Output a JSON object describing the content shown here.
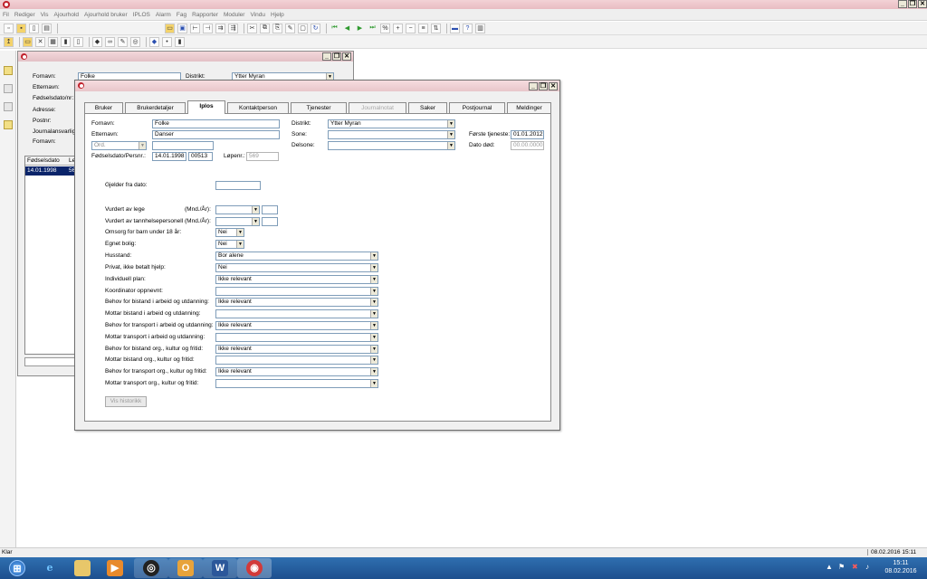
{
  "app": {
    "titlebar_buttons": {
      "minimize": "_",
      "restore": "❐",
      "close": "✕"
    }
  },
  "menu": [
    "Fil",
    "Rediger",
    "Vis",
    "Ajourhold",
    "Ajourhold bruker",
    "IPLOS",
    "Alarm",
    "Fag",
    "Rapporter",
    "Moduler",
    "Vindu",
    "Hjelp"
  ],
  "background_window": {
    "labels": {
      "fornavn": "Fornavn:",
      "etternavn": "Etternavn:",
      "fodselsdato": "Fødselsdato/nr:",
      "adresse": "Adresse:",
      "postnr": "Postnr:",
      "journalansvarlig": "Journalansvarlig",
      "fornavn2": "Fornavn:",
      "distrikt": "Distrikt:"
    },
    "fornavn_value": "Folke",
    "distrikt_value": "Ytter Myran",
    "grid_headers": [
      "Fødselsdato",
      "Le"
    ],
    "grid_rows": [
      [
        "14.01.1998",
        "56"
      ]
    ]
  },
  "dialog": {
    "tabs": [
      {
        "label": "Bruker",
        "state": "normal"
      },
      {
        "label": "Brukerdetaljer",
        "state": "normal"
      },
      {
        "label": "Iplos",
        "state": "active"
      },
      {
        "label": "Kontaktperson",
        "state": "normal"
      },
      {
        "label": "Tjenester",
        "state": "normal"
      },
      {
        "label": "Journalnotat",
        "state": "disabled"
      },
      {
        "label": "Saker",
        "state": "normal"
      },
      {
        "label": "Postjournal",
        "state": "normal"
      },
      {
        "label": "Meldinger",
        "state": "normal"
      }
    ],
    "header": {
      "fornavn_label": "Fornavn:",
      "fornavn_value": "Folke",
      "etternavn_label": "Etternavn:",
      "etternavn_value": "Danser",
      "ord_value": "Ord.",
      "fodselsdato_label": "Fødselsdato/Persnr.:",
      "fodselsdato_value": "14.01.1998",
      "persnr_value": "00513",
      "lopenr_label": "Løpenr.:",
      "lopenr_value": "569",
      "distrikt_label": "Distrikt:",
      "distrikt_value": "Ytter Myran",
      "sone_label": "Sone:",
      "delsone_label": "Delsone:",
      "forste_tjeneste_label": "Første tjeneste:",
      "forste_tjeneste_value": "01.01.2012",
      "dato_dod_label": "Dato død:",
      "dato_dod_value": "00.00.0000"
    },
    "gjelder_fra_dato_label": "Gjelder fra dato:",
    "vurdert_lege_label": "Vurdert av lege",
    "vurdert_lege_unit": "(Mnd./År):",
    "vurdert_tann_label": "Vurdert av tannhelsepersonell",
    "vurdert_tann_unit": "(Mnd./År):",
    "omsorg_label": "Omsorg for barn under 18 år:",
    "omsorg_value": "Nei",
    "egnet_bolig_label": "Egnet bolig:",
    "egnet_bolig_value": "Nei",
    "rows": [
      {
        "label": "Husstand:",
        "value": "Bor alene"
      },
      {
        "label": "Privat, ikke betalt hjelp:",
        "value": "Nei"
      },
      {
        "label": "Individuell plan:",
        "value": "Ikke relevant"
      },
      {
        "label": "Koordinator oppnevnt:",
        "value": ""
      },
      {
        "label": "Behov for bistand i arbeid og utdanning:",
        "value": "Ikke relevant"
      },
      {
        "label": "Mottar bistand i arbeid og utdanning:",
        "value": ""
      },
      {
        "label": "Behov for transport i arbeid og utdanning:",
        "value": "Ikke relevant"
      },
      {
        "label": "Mottar transport i arbeid og utdanning:",
        "value": ""
      },
      {
        "label": "Behov for bistand org., kultur og fritid:",
        "value": "Ikke relevant"
      },
      {
        "label": "Mottar bistand org., kultur og fritid:",
        "value": ""
      },
      {
        "label": "Behov for transport org., kultur og fritid:",
        "value": "Ikke relevant"
      },
      {
        "label": "Mottar transport org., kultur og fritid:",
        "value": ""
      }
    ],
    "vis_historikk_label": "Vis historikk"
  },
  "status": {
    "left": "Klar",
    "datetime": "08.02.2016 15:11"
  },
  "taskbar": {
    "time": "15:11",
    "date": "08.02.2016",
    "apps": [
      "windows-start",
      "internet-explorer",
      "file-explorer",
      "media-player",
      "app-spiral",
      "outlook",
      "word",
      "red-app"
    ]
  },
  "colors": {
    "titlebar_pink": "#f3d2d6",
    "taskbar_blue": "#1d4f8e",
    "link_disabled": "#a8a8a8"
  }
}
